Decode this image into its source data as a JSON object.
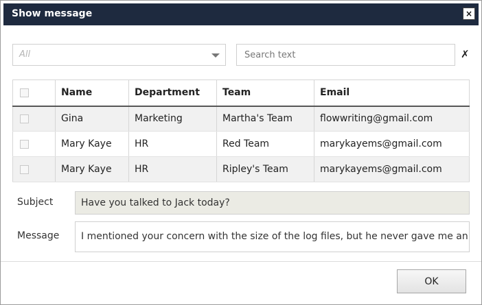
{
  "dialog": {
    "title": "Show message",
    "close_glyph": "×"
  },
  "filter": {
    "selected": "All",
    "search_placeholder": "Search text",
    "search_value": "",
    "clear_glyph": "✗"
  },
  "table": {
    "columns": [
      "",
      "Name",
      "Department",
      "Team",
      "Email"
    ],
    "rows": [
      {
        "name": "Gina",
        "department": "Marketing",
        "team": "Martha's Team",
        "email": "flowwriting@gmail.com"
      },
      {
        "name": "Mary Kaye",
        "department": "HR",
        "team": "Red Team",
        "email": "marykayems@gmail.com"
      },
      {
        "name": "Mary Kaye",
        "department": "HR",
        "team": "Ripley's Team",
        "email": "marykayems@gmail.com"
      }
    ]
  },
  "form": {
    "subject_label": "Subject",
    "subject_value": "Have you talked to Jack today?",
    "message_label": "Message",
    "message_value": "I mentioned your concern with the size of the log files, but he never gave me an answer."
  },
  "footer": {
    "ok_label": "OK"
  }
}
